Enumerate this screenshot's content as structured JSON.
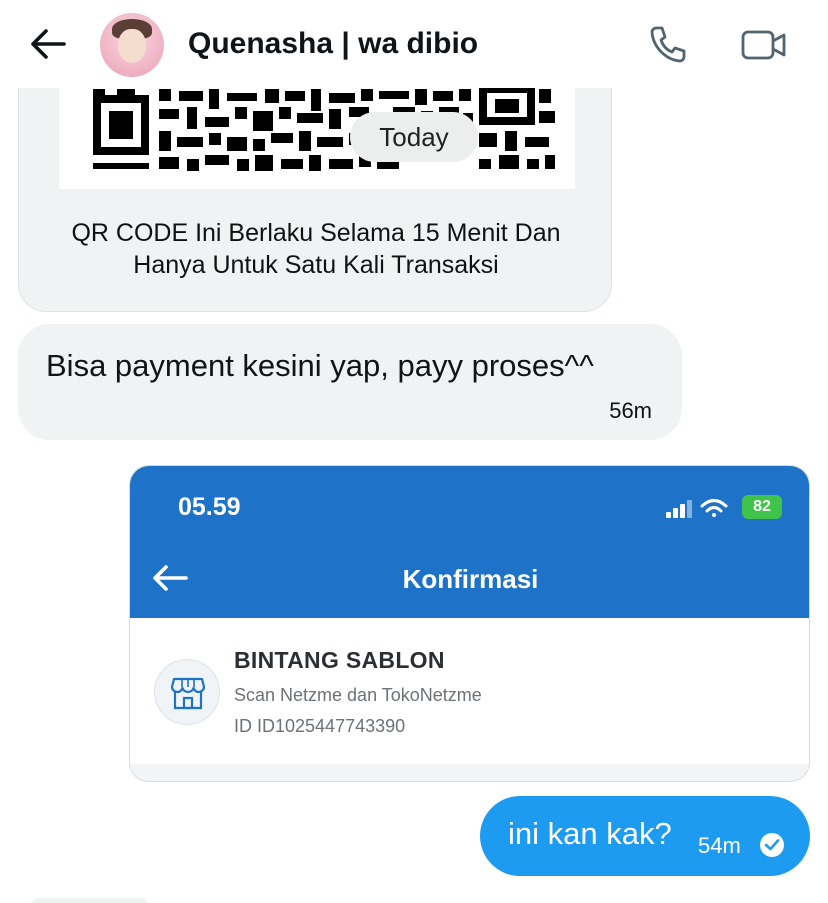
{
  "header": {
    "contact_name": "Quenasha | wa dibio",
    "back_icon": "arrow-left-icon",
    "call_icon": "phone-icon",
    "video_icon": "video-camera-icon"
  },
  "conversation": {
    "date_divider": "Today",
    "messages": [
      {
        "direction": "incoming",
        "type": "image",
        "caption": "QR CODE Ini Berlaku Selama 15 Menit Dan Hanya Untuk Satu Kali Transaksi",
        "caption_lines": [
          "QR CODE Ini Berlaku Selama 15 Menit Dan",
          "Hanya Untuk Satu Kali Transaksi"
        ]
      },
      {
        "direction": "incoming",
        "type": "text",
        "text": "Bisa payment kesini yap, payy proses^^",
        "time": "56m"
      },
      {
        "direction": "outgoing",
        "type": "image",
        "screenshot": {
          "status_time": "05.59",
          "battery": "82",
          "title": "Konfirmasi",
          "merchant_name": "BINTANG SABLON",
          "merchant_subtitle": "Scan Netzme dan TokoNetzme",
          "merchant_id": "ID ID1025447743390",
          "merchant_icon": "storefront-icon",
          "brand_color": "#1e73c9"
        }
      },
      {
        "direction": "outgoing",
        "type": "text",
        "text": "ini kan kak?",
        "time": "54m",
        "status_icon": "seen-check-icon"
      }
    ]
  },
  "colors": {
    "outgoing_bubble": "#1d9bf0",
    "incoming_bubble": "#eff3f4",
    "battery_green": "#3fc34b"
  }
}
